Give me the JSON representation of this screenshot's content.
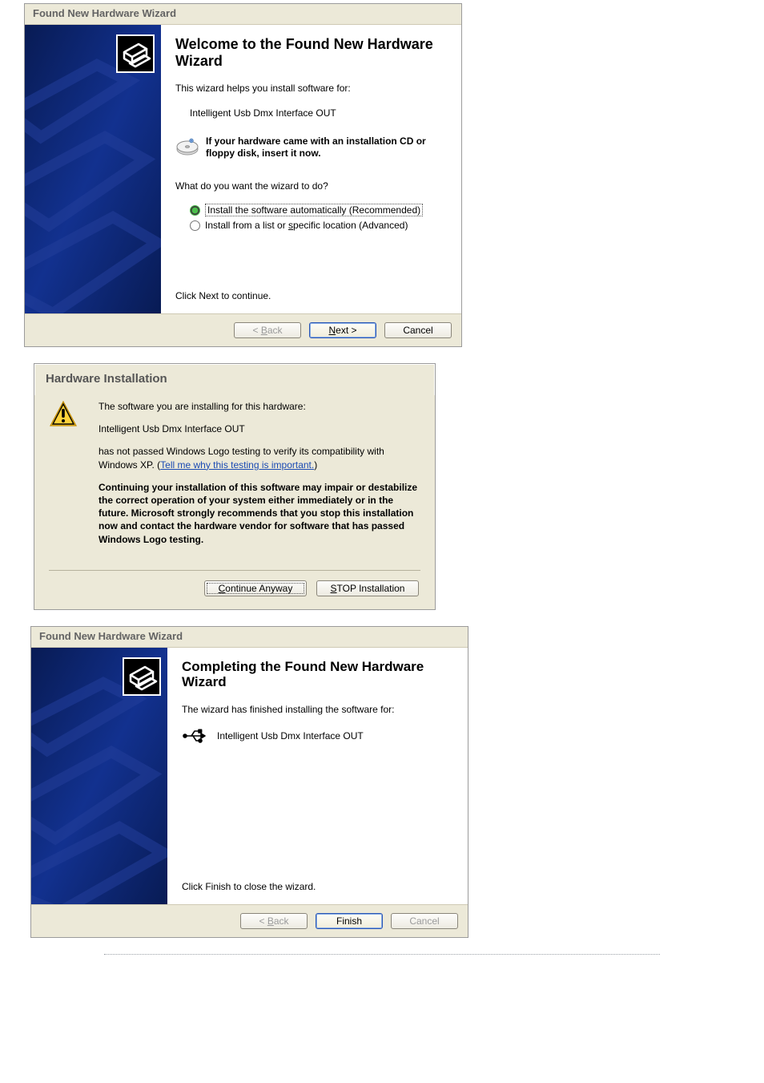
{
  "wizard1": {
    "title": "Found New Hardware Wizard",
    "heading": "Welcome to the Found New Hardware Wizard",
    "intro": "This wizard helps you install software for:",
    "device": "Intelligent Usb Dmx Interface OUT",
    "cd_hint": "If your hardware came with an installation CD or floppy disk, insert it now.",
    "question": "What do you want the wizard to do?",
    "opt_auto": "Install the software automatically (Recommended)",
    "opt_manual_pre": "Install from a list or ",
    "opt_manual_u": "s",
    "opt_manual_post": "pecific location (Advanced)",
    "click_next": "Click Next to continue.",
    "buttons": {
      "back_pre": "< ",
      "back_u": "B",
      "back_post": "ack",
      "next_u": "N",
      "next_post": "ext >",
      "cancel": "Cancel"
    }
  },
  "warn": {
    "title": "Hardware Installation",
    "p1": "The software you are installing for this hardware:",
    "device": "Intelligent Usb Dmx Interface OUT",
    "p2_pre": "has not passed Windows Logo testing to verify its compatibility with Windows XP. (",
    "p2_link": "Tell me why this testing is important.",
    "p2_post": ")",
    "bold": "Continuing your installation of this software may impair or destabilize the correct operation of your system either immediately or in the future. Microsoft strongly recommends that you stop this installation now and contact the hardware vendor for software that has passed Windows Logo testing.",
    "buttons": {
      "continue_u": "C",
      "continue_post": "ontinue Anyway",
      "stop_u": "S",
      "stop_post": "TOP Installation"
    }
  },
  "wizard3": {
    "title": "Found New Hardware Wizard",
    "heading": "Completing the Found New Hardware Wizard",
    "intro": "The wizard has finished installing the software for:",
    "device": "Intelligent Usb Dmx Interface OUT",
    "click_finish": "Click Finish to close the wizard.",
    "buttons": {
      "back_pre": "< ",
      "back_u": "B",
      "back_post": "ack",
      "finish": "Finish",
      "cancel": "Cancel"
    }
  }
}
